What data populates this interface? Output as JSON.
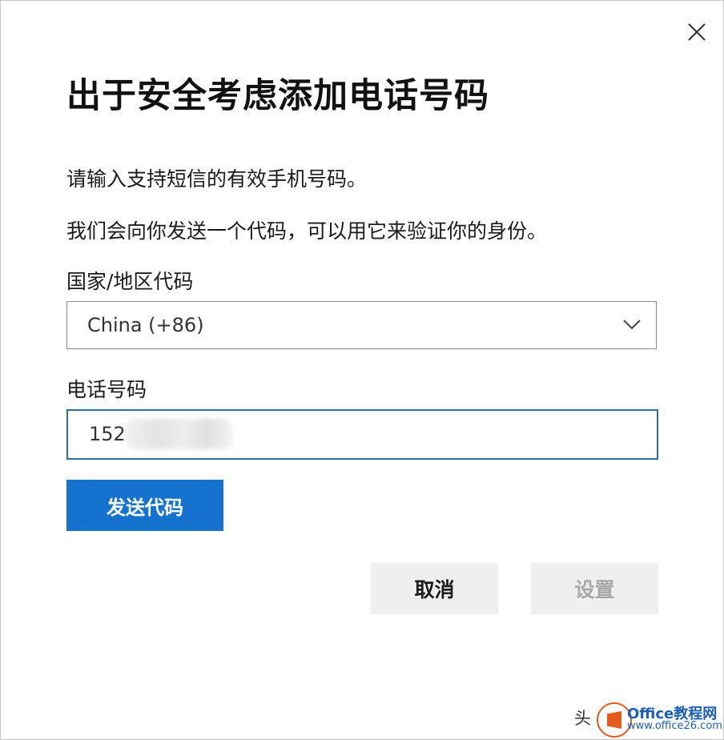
{
  "dialog": {
    "close_icon": "close-icon",
    "title": "出于安全考虑添加电话号码",
    "description_line1": "请输入支持短信的有效手机号码。",
    "description_line2": "我们会向你发送一个代码，可以用它来验证你的身份。"
  },
  "country_field": {
    "label": "国家/地区代码",
    "selected_value": "China (+86)",
    "icon": "chevron-down-icon"
  },
  "phone_field": {
    "label": "电话号码",
    "value": "152"
  },
  "buttons": {
    "send_code": "发送代码",
    "cancel": "取消",
    "set": "设置"
  },
  "watermark": {
    "prefix": "头",
    "brand": "Office教程网",
    "url": "www.office26.com"
  },
  "colors": {
    "primary_button": "#1672cf",
    "input_focus_border": "#2f6ea5",
    "secondary_button_bg": "#efefef",
    "disabled_text": "#a8a8a8"
  }
}
